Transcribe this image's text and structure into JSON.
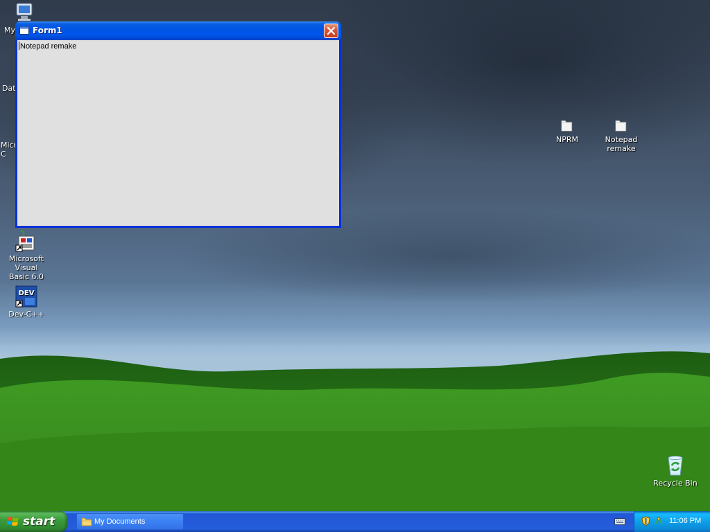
{
  "desktop": {
    "icons": [
      {
        "label": "My"
      },
      {
        "label": "Dat"
      },
      {
        "label": "Micro\nC"
      },
      {
        "label": "Microsoft Visual\nBasic 6.0"
      },
      {
        "label": "Dev-C++"
      },
      {
        "label": "NPRM"
      },
      {
        "label": "Notepad\nremake"
      },
      {
        "label": "Recycle Bin"
      }
    ]
  },
  "window": {
    "title": "Form1",
    "content_text": "Notepad remake"
  },
  "taskbar": {
    "start_label": "start",
    "tasks": [
      {
        "label": "My Documents"
      }
    ],
    "clock": "11:06 PM"
  },
  "icons": {
    "computer": "computer-icon",
    "database": "database-icon",
    "vb6": "visual-basic-icon",
    "devcpp": "dev-cpp-icon",
    "folder": "folder-icon",
    "recycle": "recycle-bin-icon",
    "close": "close-icon",
    "start": "windows-logo-icon",
    "keyboard": "keyboard-icon",
    "security": "security-shield-icon",
    "network": "network-icon"
  },
  "colors": {
    "titlebar": "#0054e3",
    "start_button": "#3c9d3c",
    "taskbar": "#245edb",
    "tray": "#0f9fea",
    "window_client": "#e0e0e0"
  }
}
